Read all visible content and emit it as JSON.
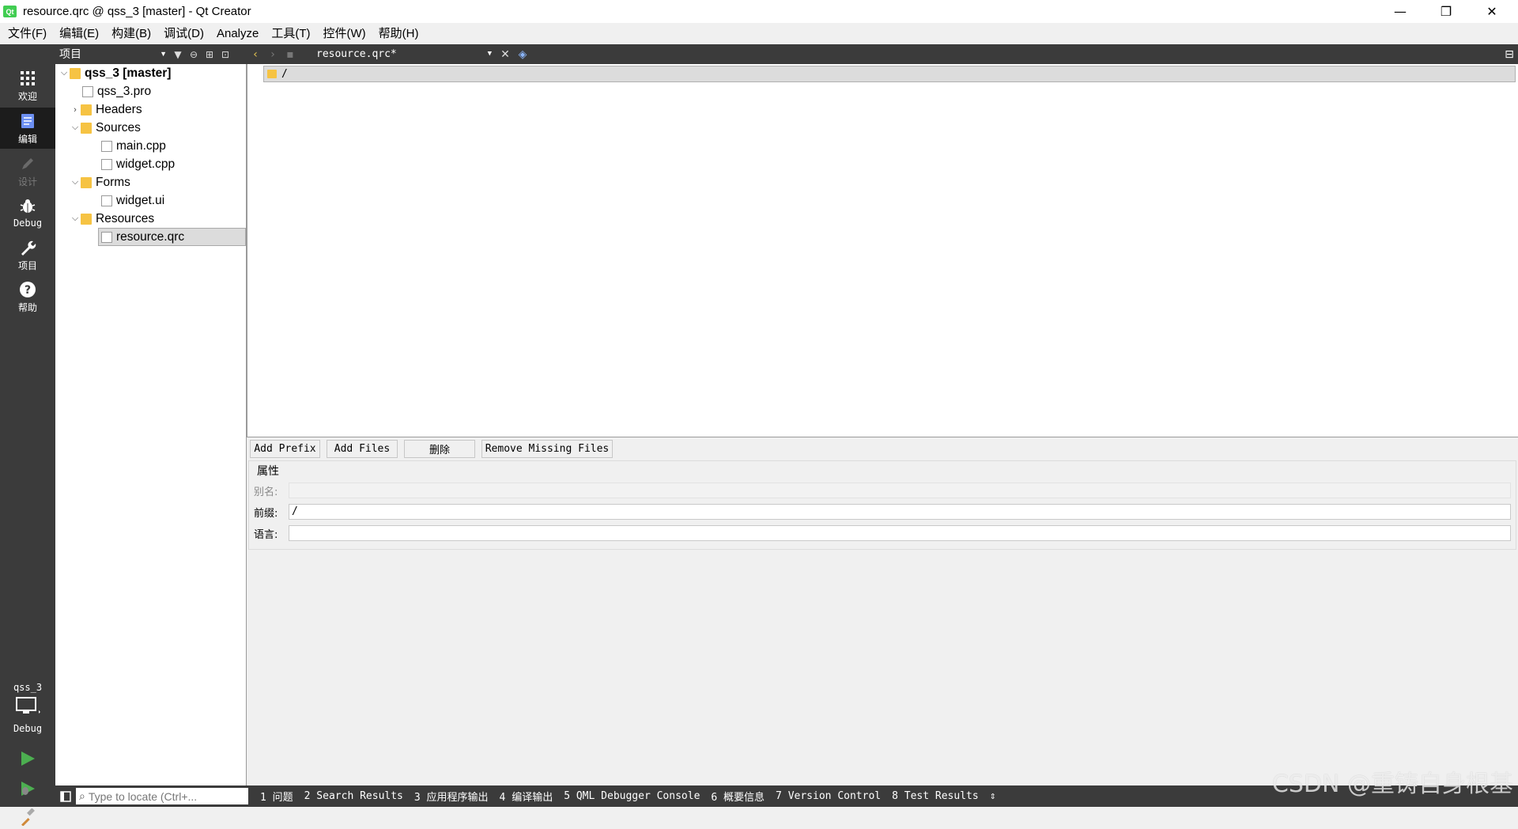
{
  "window": {
    "title": "resource.qrc @ qss_3 [master] - Qt Creator",
    "app_icon_text": "Qt",
    "controls": {
      "minimize": "—",
      "maximize": "❐",
      "close": "✕"
    }
  },
  "menubar": {
    "items": [
      "文件(F)",
      "编辑(E)",
      "构建(B)",
      "调试(D)",
      "Analyze",
      "工具(T)",
      "控件(W)",
      "帮助(H)"
    ]
  },
  "modes": [
    {
      "label": "欢迎",
      "icon": "grid-icon",
      "state": "normal"
    },
    {
      "label": "编辑",
      "icon": "document-icon",
      "state": "active"
    },
    {
      "label": "设计",
      "icon": "pencil-icon",
      "state": "disabled"
    },
    {
      "label": "Debug",
      "icon": "bug-icon",
      "state": "normal"
    },
    {
      "label": "项目",
      "icon": "wrench-icon",
      "state": "normal"
    },
    {
      "label": "帮助",
      "icon": "help-icon",
      "state": "normal"
    }
  ],
  "kit": {
    "name": "qss_3",
    "mode": "Debug"
  },
  "project_panel": {
    "selector": "项目",
    "tree": [
      {
        "label": "qss_3 [master]",
        "level": 0,
        "expanded": true,
        "type": "project",
        "bold": true
      },
      {
        "label": "qss_3.pro",
        "level": 1,
        "type": "pro-file"
      },
      {
        "label": "Headers",
        "level": 1,
        "expanded": false,
        "type": "folder"
      },
      {
        "label": "Sources",
        "level": 1,
        "expanded": true,
        "type": "folder"
      },
      {
        "label": "main.cpp",
        "level": 2,
        "type": "cpp-file"
      },
      {
        "label": "widget.cpp",
        "level": 2,
        "type": "cpp-file"
      },
      {
        "label": "Forms",
        "level": 1,
        "expanded": true,
        "type": "folder"
      },
      {
        "label": "widget.ui",
        "level": 2,
        "type": "ui-file"
      },
      {
        "label": "Resources",
        "level": 1,
        "expanded": true,
        "type": "folder"
      },
      {
        "label": "resource.qrc",
        "level": 2,
        "type": "qrc-file",
        "selected": true
      }
    ]
  },
  "editor": {
    "document": "resource.qrc*",
    "resource_tree": {
      "prefix": "/"
    },
    "buttons": {
      "add_prefix": "Add Prefix",
      "add_files": "Add Files",
      "delete": "删除",
      "remove_missing": "Remove Missing Files"
    },
    "properties": {
      "title": "属性",
      "alias_label": "别名:",
      "alias_value": "",
      "prefix_label": "前缀:",
      "prefix_value": "/",
      "language_label": "语言:",
      "language_value": ""
    }
  },
  "statusbar": {
    "locator_placeholder": "Type to locate (Ctrl+...",
    "panes": [
      "1 问题",
      "2 Search Results",
      "3 应用程序输出",
      "4 编译输出",
      "5 QML Debugger Console",
      "6 概要信息",
      "7 Version Control",
      "8 Test Results"
    ],
    "more": "⇕"
  },
  "watermark": "CSDN @重铸自身根基",
  "colors": {
    "dark_bar": "#3b3b3b",
    "active_mode": "#1c1c1c",
    "folder": "#f6c343",
    "run_green": "#4caf50"
  }
}
